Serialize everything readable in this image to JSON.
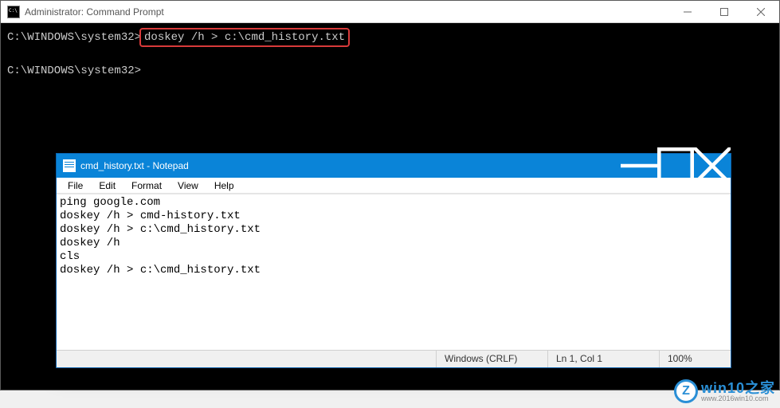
{
  "cmd": {
    "title": "Administrator: Command Prompt",
    "prompt1_path": "C:\\WINDOWS\\system32>",
    "prompt1_cmd": "doskey /h > c:\\cmd_history.txt",
    "prompt2": "C:\\WINDOWS\\system32>"
  },
  "notepad": {
    "title": "cmd_history.txt - Notepad",
    "menu": {
      "file": "File",
      "edit": "Edit",
      "format": "Format",
      "view": "View",
      "help": "Help"
    },
    "content_lines": [
      "ping google.com",
      "doskey /h > cmd-history.txt",
      "doskey /h > c:\\cmd_history.txt",
      "doskey /h",
      "cls",
      "doskey /h > c:\\cmd_history.txt"
    ],
    "status": {
      "eol": "Windows (CRLF)",
      "cursor": "Ln 1, Col 1",
      "zoom": "100%"
    }
  },
  "watermark": {
    "glyph": "Z",
    "main": "win10之家",
    "sub": "www.2016win10.com"
  }
}
